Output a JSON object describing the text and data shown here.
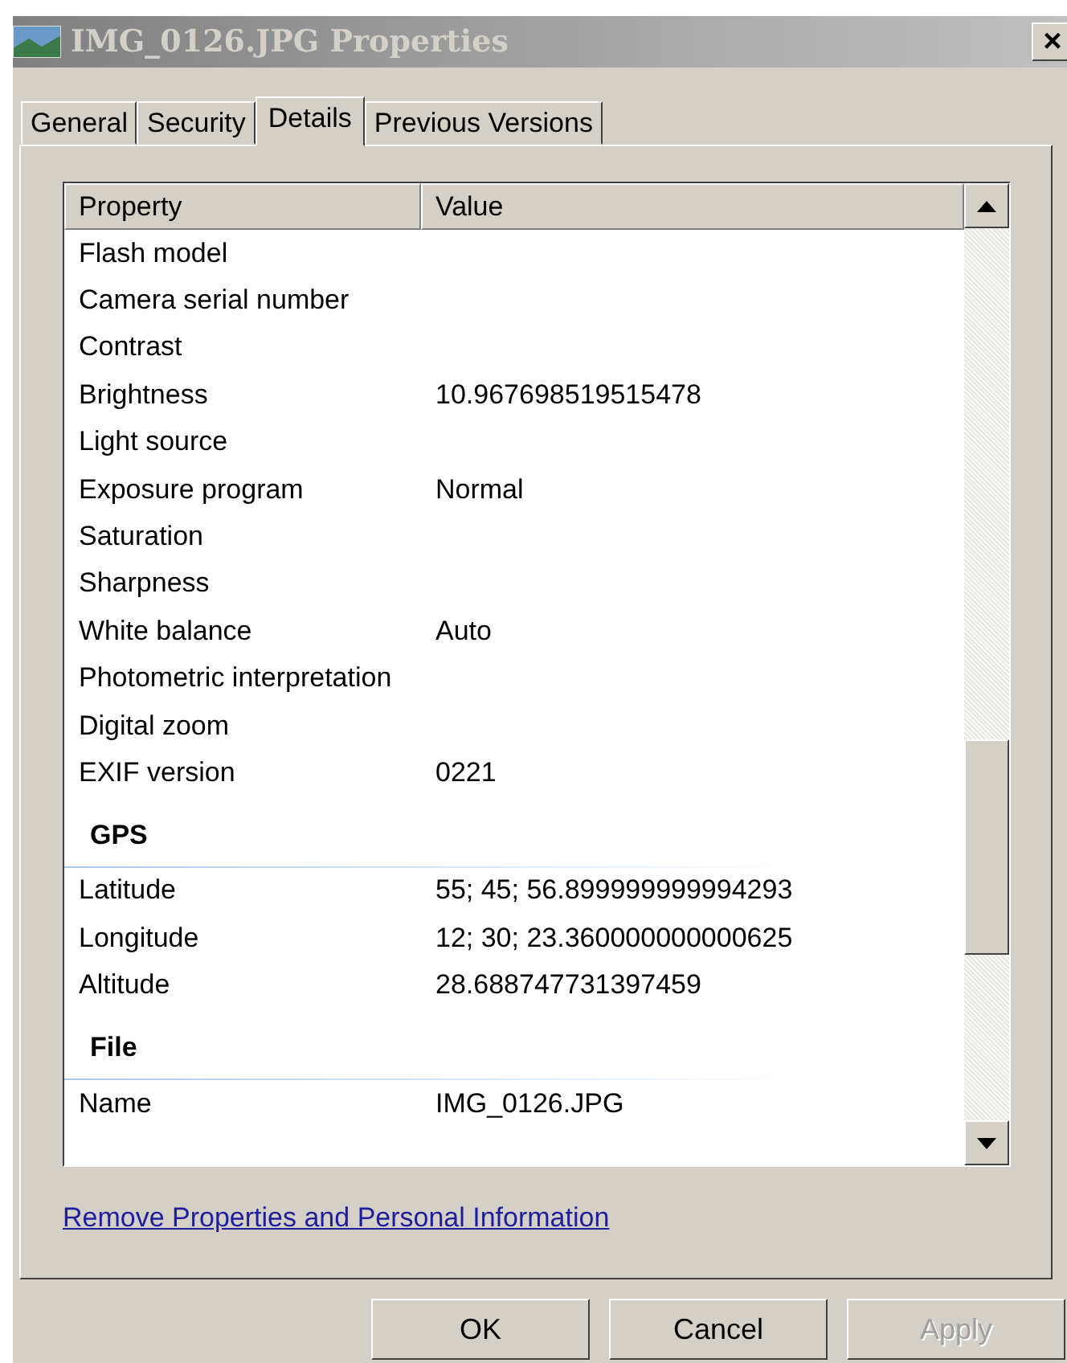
{
  "window": {
    "title": "IMG_0126.JPG Properties",
    "close": "×"
  },
  "tabs": [
    {
      "label": "General",
      "selected": false
    },
    {
      "label": "Security",
      "selected": false
    },
    {
      "label": "Details",
      "selected": true
    },
    {
      "label": "Previous Versions",
      "selected": false
    }
  ],
  "table": {
    "columns": [
      "Property",
      "Value"
    ],
    "rows": [
      {
        "kind": "property",
        "property": "Flash model"
      },
      {
        "kind": "property",
        "property": "Camera serial number"
      },
      {
        "kind": "property",
        "property": "Contrast"
      },
      {
        "kind": "property",
        "property": "Brightness",
        "value": "10.967698519515478"
      },
      {
        "kind": "property",
        "property": "Light source"
      },
      {
        "kind": "property",
        "property": "Exposure program",
        "value": "Normal"
      },
      {
        "kind": "property",
        "property": "Saturation"
      },
      {
        "kind": "property",
        "property": "Sharpness"
      },
      {
        "kind": "property",
        "property": "White balance",
        "value": "Auto"
      },
      {
        "kind": "property",
        "property": "Photometric interpretation"
      },
      {
        "kind": "property",
        "property": "Digital zoom"
      },
      {
        "kind": "property",
        "property": "EXIF version",
        "value": "0221"
      },
      {
        "kind": "group",
        "property": "GPS"
      },
      {
        "kind": "property",
        "property": "Latitude",
        "value": "55; 45; 56.899999999994293"
      },
      {
        "kind": "property",
        "property": "Longitude",
        "value": "12; 30; 23.360000000000625"
      },
      {
        "kind": "property",
        "property": "Altitude",
        "value": "28.688747731397459"
      },
      {
        "kind": "group",
        "property": "File"
      },
      {
        "kind": "property",
        "property": "Name",
        "value": "IMG_0126.JPG"
      }
    ]
  },
  "link": "Remove Properties and Personal Information",
  "buttons": [
    {
      "label": "OK",
      "disabled": false
    },
    {
      "label": "Cancel",
      "disabled": false
    },
    {
      "label": "Apply",
      "disabled": true
    }
  ]
}
